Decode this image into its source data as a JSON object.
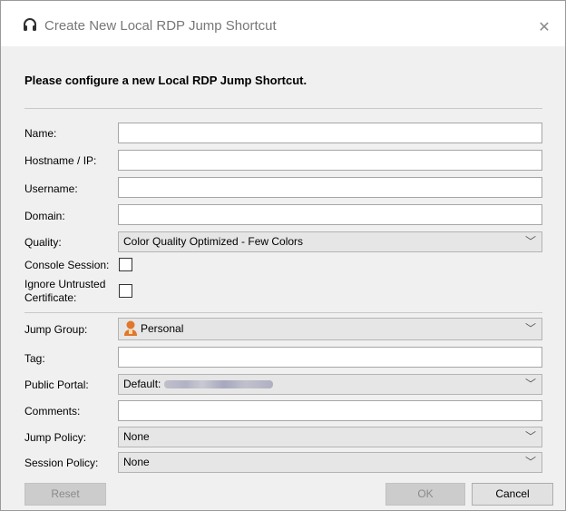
{
  "window": {
    "title": "Create New Local RDP Jump Shortcut",
    "close_glyph": "✕"
  },
  "form": {
    "heading": "Please configure a new Local RDP Jump Shortcut.",
    "name_label": "Name:",
    "name_value": "",
    "hostname_label": "Hostname / IP:",
    "hostname_value": "",
    "username_label": "Username:",
    "username_value": "",
    "domain_label": "Domain:",
    "domain_value": "",
    "quality_label": "Quality:",
    "quality_value": "Color Quality Optimized - Few Colors",
    "console_label": "Console Session:",
    "console_checked": false,
    "ignore_cert_label_1": "Ignore Untrusted",
    "ignore_cert_label_2": "Certificate:",
    "ignore_cert_checked": false,
    "jump_group_label": "Jump Group:",
    "jump_group_value": "Personal",
    "tag_label": "Tag:",
    "tag_value": "",
    "public_portal_label": "Public Portal:",
    "public_portal_value": "Default:",
    "comments_label": "Comments:",
    "comments_value": "",
    "jump_policy_label": "Jump Policy:",
    "jump_policy_value": "None",
    "session_policy_label": "Session Policy:",
    "session_policy_value": "None",
    "chevron": "﹀"
  },
  "buttons": {
    "reset": "Reset",
    "ok": "OK",
    "cancel": "Cancel"
  },
  "icons": {
    "title": "headset-icon",
    "jump_group": "person-icon"
  },
  "colors": {
    "person_icon": "#e0772a"
  }
}
